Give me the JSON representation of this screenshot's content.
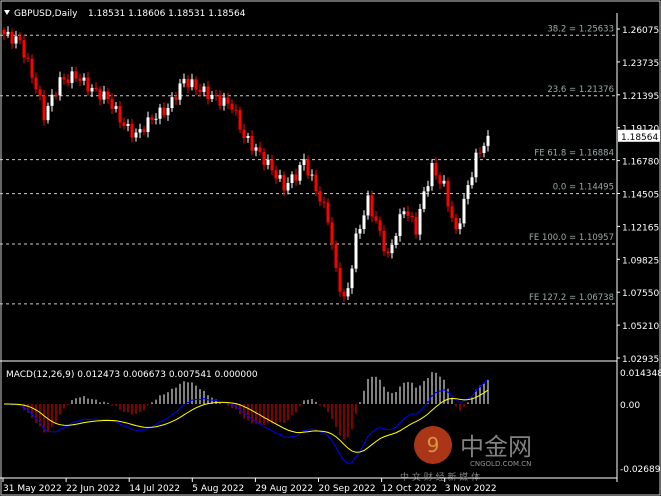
{
  "header": {
    "symbol": "GBPUSD,Daily",
    "ohlc": "1.18531 1.18606 1.18531 1.18564"
  },
  "chart_data": {
    "type": "candlestick",
    "title": "GBPUSD,Daily",
    "ylim": [
      1.02935,
      1.26075
    ],
    "y_ticks": [
      "1.26075",
      "1.23735",
      "1.21395",
      "1.19120",
      "1.16780",
      "1.14505",
      "1.12165",
      "1.09825",
      "1.07550",
      "1.05210",
      "1.02935"
    ],
    "current_price": "1.18564",
    "x_ticks": [
      "31 May 2022",
      "22 Jun 2022",
      "14 Jul 2022",
      "5 Aug 2022",
      "29 Aug 2022",
      "20 Sep 2022",
      "12 Oct 2022",
      "3 Nov 2022"
    ],
    "close_keypoints": [
      [
        0,
        1.257
      ],
      [
        4,
        1.252
      ],
      [
        8,
        1.22
      ],
      [
        10,
        1.2
      ],
      [
        14,
        1.224
      ],
      [
        18,
        1.228
      ],
      [
        22,
        1.218
      ],
      [
        26,
        1.212
      ],
      [
        30,
        1.193
      ],
      [
        33,
        1.186
      ],
      [
        37,
        1.198
      ],
      [
        41,
        1.205
      ],
      [
        45,
        1.225
      ],
      [
        49,
        1.218
      ],
      [
        53,
        1.212
      ],
      [
        57,
        1.207
      ],
      [
        60,
        1.185
      ],
      [
        63,
        1.176
      ],
      [
        67,
        1.162
      ],
      [
        70,
        1.15
      ],
      [
        73,
        1.158
      ],
      [
        75,
        1.168
      ],
      [
        78,
        1.148
      ],
      [
        81,
        1.128
      ],
      [
        83,
        1.09
      ],
      [
        85,
        1.07
      ],
      [
        86,
        1.078
      ],
      [
        88,
        1.113
      ],
      [
        91,
        1.14
      ],
      [
        93,
        1.125
      ],
      [
        96,
        1.1
      ],
      [
        98,
        1.118
      ],
      [
        100,
        1.135
      ],
      [
        103,
        1.12
      ],
      [
        105,
        1.145
      ],
      [
        107,
        1.163
      ],
      [
        110,
        1.15
      ],
      [
        113,
        1.117
      ],
      [
        116,
        1.15
      ],
      [
        118,
        1.17
      ],
      [
        119,
        1.175
      ],
      [
        121,
        1.1856
      ]
    ],
    "levels": [
      {
        "label": "38.2 = 1.25633",
        "price": 1.25633
      },
      {
        "label": "23.6 = 1.21376",
        "price": 1.21376
      },
      {
        "label": "FE 61.8 = 1.16884",
        "price": 1.16884
      },
      {
        "label": "0.0 = 1.14495",
        "price": 1.14495
      },
      {
        "label": "FE 100.0 = 1.10957",
        "price": 1.10957
      },
      {
        "label": "FE 127.2 = 1.06738",
        "price": 1.06738
      }
    ],
    "macd": {
      "label": "MACD(12,26,9) 0.012473 0.006673 0.007541 0.000000",
      "y_ticks": [
        "0.014348",
        "0.00",
        "-0.026896"
      ],
      "ylim": [
        -0.026896,
        0.014348
      ]
    },
    "colors": {
      "bull": "#ffffff",
      "bear": "#ff0000",
      "signal": "#ffff00",
      "macd_line": "#0000ff"
    }
  },
  "watermark": {
    "brand": "中金网",
    "site": "CNGOLD.COM.CN",
    "tagline": "中 文 财 经 新 媒 体"
  }
}
